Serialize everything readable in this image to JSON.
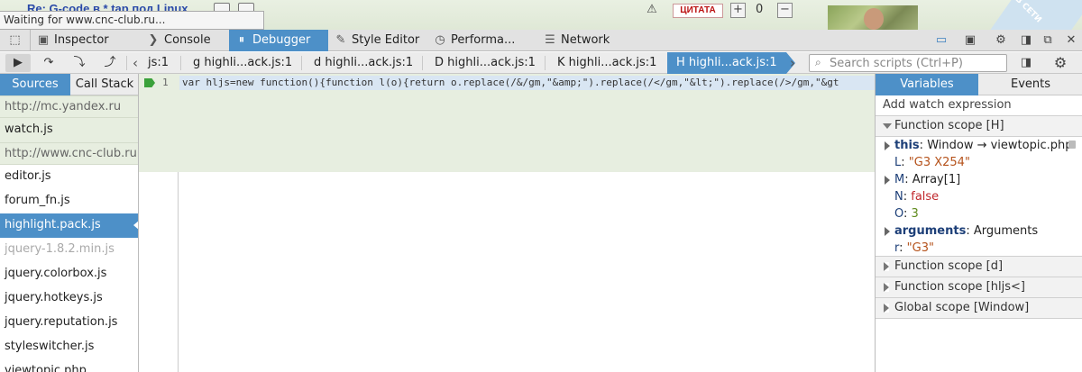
{
  "page": {
    "title": "Re: G-code в * tap под Linux",
    "status": "Waiting for www.cnc-club.ru...",
    "quote_label": "ЦИТАТА",
    "vote_count": "0",
    "corner_label": "В СЕТИ"
  },
  "devtools": {
    "tabs": [
      {
        "label": "Inspector",
        "icon": "inspector-icon"
      },
      {
        "label": "Console",
        "icon": "console-icon"
      },
      {
        "label": "Debugger",
        "icon": "debugger-icon"
      },
      {
        "label": "Style Editor",
        "icon": "style-editor-icon"
      },
      {
        "label": "Performa...",
        "icon": "performance-icon"
      },
      {
        "label": "Network",
        "icon": "network-icon"
      }
    ],
    "active_tab": "Debugger",
    "accent_color": "#4d90c8"
  },
  "debugger": {
    "breadcrumbs": [
      "js:1",
      "g highli...ack.js:1",
      "d highli...ack.js:1",
      "D highli...ack.js:1",
      "K highli...ack.js:1",
      "H highli...ack.js:1"
    ],
    "search_placeholder": "Search scripts (Ctrl+P)",
    "left_tabs": {
      "sources": "Sources",
      "call_stack": "Call Stack"
    },
    "sources": [
      {
        "label": "http://mc.yandex.ru",
        "kind": "group"
      },
      {
        "label": "watch.js",
        "kind": "file-shaded"
      },
      {
        "label": "http://www.cnc-club.ru",
        "kind": "group"
      },
      {
        "label": "editor.js",
        "kind": "file"
      },
      {
        "label": "forum_fn.js",
        "kind": "file"
      },
      {
        "label": "highlight.pack.js",
        "kind": "selected"
      },
      {
        "label": "jquery-1.8.2.min.js",
        "kind": "blackboxed"
      },
      {
        "label": "jquery.colorbox.js",
        "kind": "file"
      },
      {
        "label": "jquery.hotkeys.js",
        "kind": "file"
      },
      {
        "label": "jquery.reputation.js",
        "kind": "file"
      },
      {
        "label": "styleswitcher.js",
        "kind": "file"
      },
      {
        "label": "viewtopic.php",
        "kind": "file"
      }
    ],
    "editor": {
      "line_number": "1",
      "code": "var hljs=new function(){function l(o){return o.replace(/&/gm,\"&amp;\").replace(/</gm,\"&lt;\").replace(/>/gm,\"&gt"
    },
    "right_tabs": {
      "variables": "Variables",
      "events": "Events"
    },
    "watch_placeholder": "Add watch expression",
    "scopes": [
      {
        "label": "Function scope [H]",
        "expanded": true,
        "vars": [
          {
            "name": "this",
            "value": "Window → viewtopic.php",
            "type": "obj",
            "expandable": true,
            "bold": true,
            "locked": true
          },
          {
            "name": "L",
            "value": "\"G3 X254\"",
            "type": "str",
            "expandable": false,
            "bold": false
          },
          {
            "name": "M",
            "value": "Array[1]",
            "type": "obj",
            "expandable": true,
            "bold": false
          },
          {
            "name": "N",
            "value": "false",
            "type": "bool",
            "expandable": false,
            "bold": false
          },
          {
            "name": "O",
            "value": "3",
            "type": "num",
            "expandable": false,
            "bold": false
          },
          {
            "name": "arguments",
            "value": "Arguments",
            "type": "obj",
            "expandable": true,
            "bold": true
          },
          {
            "name": "r",
            "value": "\"G3\"",
            "type": "str",
            "expandable": false,
            "bold": false
          }
        ]
      },
      {
        "label": "Function scope [d]",
        "expanded": false,
        "vars": []
      },
      {
        "label": "Function scope [hljs<]",
        "expanded": false,
        "vars": []
      },
      {
        "label": "Global scope [Window]",
        "expanded": false,
        "vars": []
      }
    ]
  }
}
